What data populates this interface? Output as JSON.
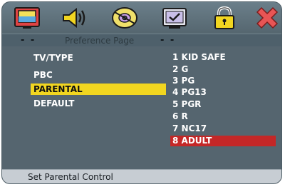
{
  "toolbar": {
    "icons": [
      {
        "name": "general-setup-tv-icon"
      },
      {
        "name": "audio-setup-speaker-icon"
      },
      {
        "name": "video-setup-disc-icon"
      },
      {
        "name": "preference-setup-screen-icon"
      },
      {
        "name": "parental-lock-icon"
      },
      {
        "name": "exit-x-icon"
      }
    ]
  },
  "title_bar": {
    "left_dashes": "- -",
    "title": "Preference Page",
    "right_dashes": "- -"
  },
  "menu": {
    "items": [
      {
        "label": "TV/TYPE"
      },
      {
        "label": "PBC"
      },
      {
        "label": "PARENTAL"
      },
      {
        "label": "DEFAULT"
      }
    ],
    "selected": "PARENTAL"
  },
  "options": {
    "items": [
      {
        "label": "1 KID SAFE"
      },
      {
        "label": "2 G"
      },
      {
        "label": "3 PG"
      },
      {
        "label": "4 PG13"
      },
      {
        "label": "5 PGR"
      },
      {
        "label": "6 R"
      },
      {
        "label": "7 NC17"
      },
      {
        "label": "8 ADULT"
      }
    ],
    "selected": "8 ADULT"
  },
  "status": {
    "text": "Set Parental Control"
  },
  "colors": {
    "menu_highlight": "#f2d620",
    "option_highlight": "#c42727"
  }
}
